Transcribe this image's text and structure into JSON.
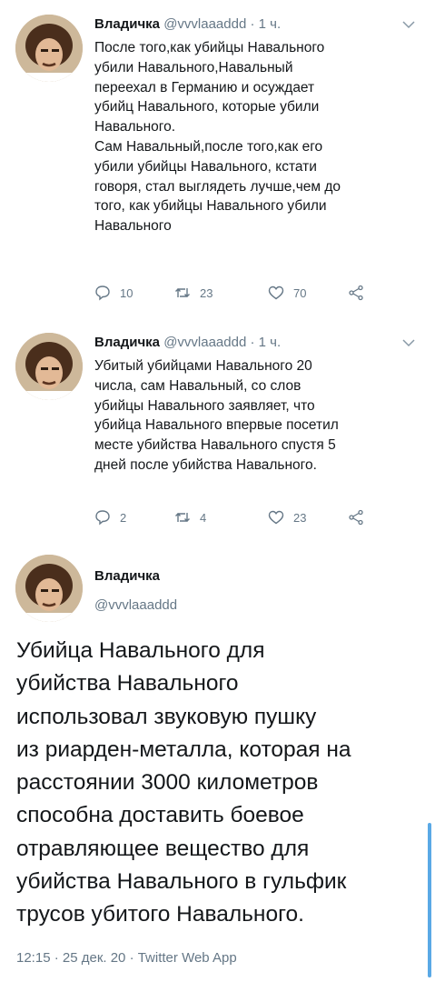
{
  "tweets": [
    {
      "name": "Владичка",
      "handle": "@vvvlaaaddd",
      "dot": "·",
      "time": "1 ч.",
      "text": "После того,как убийцы Навального\nубили Навального,Навальный\nпереехал в Германию и осуждает\nубийц Навального, которые убили\nНавального.\nСам Навальный,после того,как его\nубили убийцы Навального, кстати\nговоря, стал выглядеть лучше,чем до\nтого, как убийцы Навального убили\nНавального",
      "replies": "10",
      "retweets": "23",
      "likes": "70"
    },
    {
      "name": "Владичка",
      "handle": "@vvvlaaaddd",
      "dot": "·",
      "time": "1 ч.",
      "text": "Убитый убийцами Навального 20\nчисла, сам Навальный, со слов\nубийцы Навального заявляет, что\nубийца Навального впервые посетил\nместе убийства Навального спустя 5\nдней после убийства Навального.",
      "replies": "2",
      "retweets": "4",
      "likes": "23"
    }
  ],
  "main_tweet": {
    "name": "Владичка",
    "handle": "@vvvlaaaddd",
    "text": "Убийца Навального для\nубийства Навального\nиспользовал звуковую пушку\nиз риарден-металла, которая на\nрасстоянии 3000 километров\nспособна доставить боевое\nотравляющее вещество для\nубийства Навального в гульфик\nтрусов убитого Навального.",
    "meta": "12:15 · 25 дек. 20 · Twitter Web App"
  },
  "icons": {
    "reply": "reply-icon",
    "retweet": "retweet-icon",
    "like": "heart-icon",
    "share": "share-icon",
    "menu": "chevron-down-icon"
  },
  "colors": {
    "text": "#14171a",
    "secondary": "#657786",
    "accent": "#5aa9e6"
  }
}
